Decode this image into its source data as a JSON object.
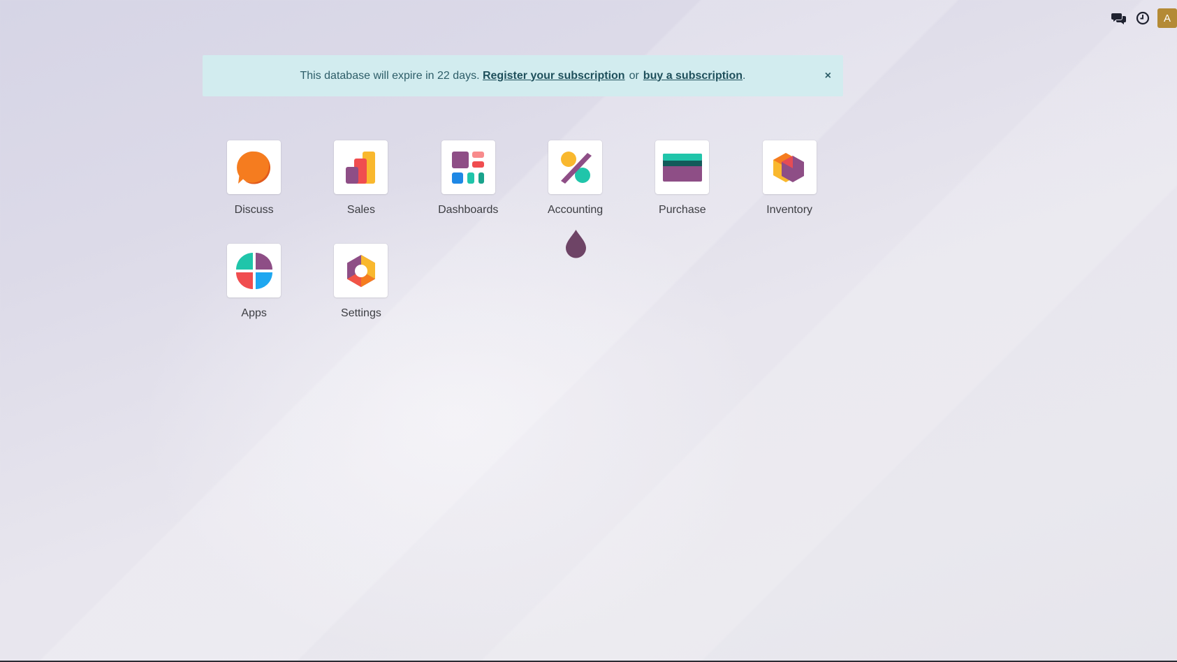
{
  "topbar": {
    "icons": [
      "chat-icon",
      "clock-icon"
    ],
    "avatar_letter": "A",
    "avatar_color": "#b48a35"
  },
  "alert": {
    "text": "This database will expire in 22 days.",
    "register_link": "Register your subscription",
    "or_text": "or",
    "buy_link": "buy a subscription",
    "period": ".",
    "close_label": "×",
    "bg_color": "#d2ecef"
  },
  "apps": [
    {
      "label": "Discuss",
      "icon": "discuss-icon"
    },
    {
      "label": "Sales",
      "icon": "sales-icon"
    },
    {
      "label": "Dashboards",
      "icon": "dashboards-icon"
    },
    {
      "label": "Accounting",
      "icon": "accounting-icon"
    },
    {
      "label": "Purchase",
      "icon": "purchase-icon"
    },
    {
      "label": "Inventory",
      "icon": "inventory-icon"
    },
    {
      "label": "Apps",
      "icon": "apps-icon"
    },
    {
      "label": "Settings",
      "icon": "settings-icon"
    }
  ],
  "colors": {
    "purple": "#8e4e86",
    "orange": "#f57c1f",
    "teal": "#20c5aa",
    "red": "#f04d4f",
    "blue": "#1ea7f0",
    "yellow": "#f9b82e"
  }
}
